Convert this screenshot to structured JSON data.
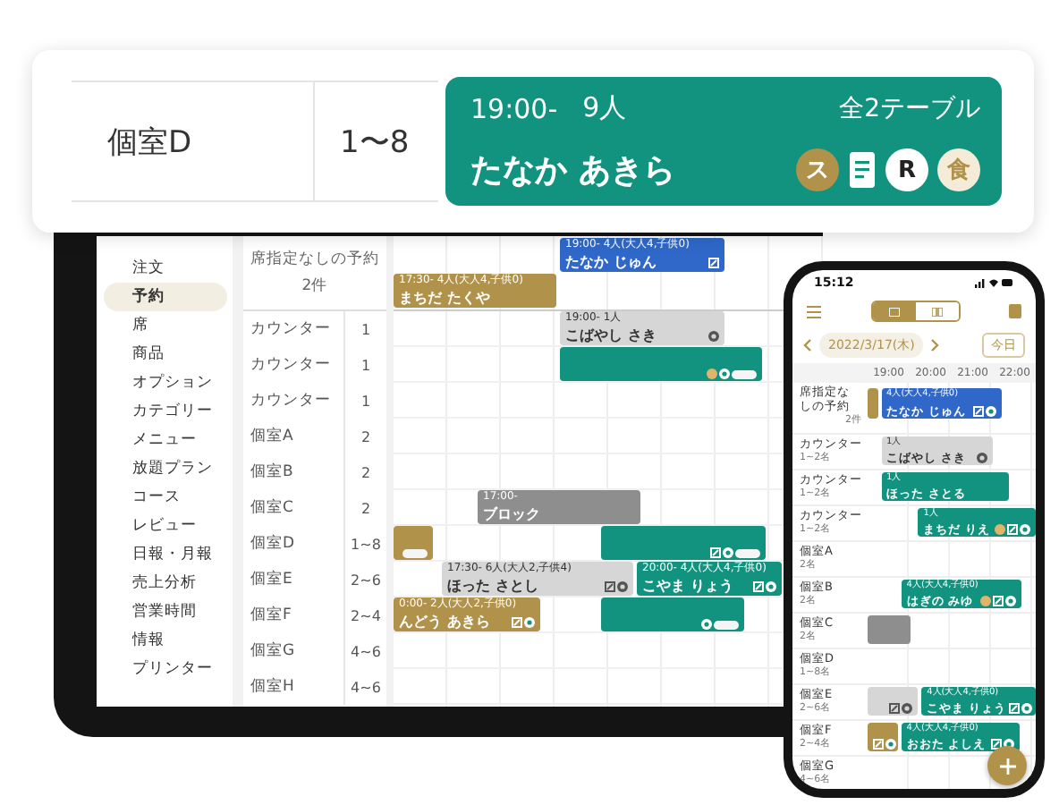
{
  "callout": {
    "seat": "個室D",
    "capacity": "1〜8",
    "booking": {
      "time": "19:00-",
      "party": "9人",
      "tables": "全2テーブル",
      "name": "たなか あきら",
      "color": "#12937f",
      "badges": [
        {
          "kind": "letter",
          "text": "ス"
        },
        {
          "kind": "document"
        },
        {
          "kind": "logo",
          "text": "R"
        },
        {
          "kind": "cream",
          "text": "食"
        }
      ]
    }
  },
  "tablet": {
    "sidebar": [
      {
        "label": "注文",
        "selected": false
      },
      {
        "label": "予約",
        "selected": true
      },
      {
        "label": "席",
        "selected": false
      },
      {
        "label": "商品",
        "selected": false
      },
      {
        "label": "オプション",
        "selected": false
      },
      {
        "label": "カテゴリー",
        "selected": false
      },
      {
        "label": "メニュー",
        "selected": false
      },
      {
        "label": "放題プラン",
        "selected": false
      },
      {
        "label": "コース",
        "selected": false
      },
      {
        "label": "レビュー",
        "selected": false
      },
      {
        "label": "日報・月報",
        "selected": false
      },
      {
        "label": "売上分析",
        "selected": false
      },
      {
        "label": "営業時間",
        "selected": false
      },
      {
        "label": "情報",
        "selected": false
      },
      {
        "label": "プリンター",
        "selected": false
      }
    ],
    "unassigned": {
      "label": "席指定なしの予約",
      "count": "2件",
      "bookings": [
        {
          "time": "19:00-  4人(大人4,子供0)",
          "name": "たなか じゅん",
          "color": "#2f68c8",
          "icons": [
            {
              "kind": "edit"
            }
          ]
        },
        {
          "time": "17:30-  4人(大人4,子供0)",
          "name": "まちだ たくや",
          "color": "#b0924a"
        }
      ]
    },
    "rows": [
      {
        "name": "カウンター",
        "capacity": "1",
        "bookings": [
          {
            "time": "19:00-  1人",
            "name": "こばやし さき",
            "color": "#d6d6d6",
            "icons": [
              {
                "kind": "seat"
              }
            ]
          }
        ]
      },
      {
        "name": "カウンター",
        "capacity": "1",
        "bookings": [
          {
            "color": "#12937f",
            "icons": [
              {
                "kind": "person"
              },
              {
                "kind": "seat"
              },
              {
                "kind": "tag"
              }
            ]
          }
        ]
      },
      {
        "name": "カウンター",
        "capacity": "1",
        "bookings": []
      },
      {
        "name": "個室A",
        "capacity": "2",
        "bookings": []
      },
      {
        "name": "個室B",
        "capacity": "2",
        "bookings": []
      },
      {
        "name": "個室C",
        "capacity": "2",
        "bookings": [
          {
            "time": "17:00-",
            "name": "ブロック",
            "color": "#8e8e8e"
          }
        ]
      },
      {
        "name": "個室D",
        "capacity": "1~8",
        "bookings": [
          {
            "color": "#b0924a",
            "icons": [
              {
                "kind": "tag"
              }
            ]
          },
          {
            "color": "#12937f",
            "icons": [
              {
                "kind": "edit"
              },
              {
                "kind": "seat"
              },
              {
                "kind": "tag"
              }
            ]
          }
        ]
      },
      {
        "name": "個室E",
        "capacity": "2~6",
        "bookings": [
          {
            "time": "17:30-  6人(大人2,子供4)",
            "name": "ほった さとし",
            "color": "#d6d6d6",
            "icons": [
              {
                "kind": "edit"
              },
              {
                "kind": "seat"
              }
            ]
          },
          {
            "time": "20:00-  4人(大人4,子供0)",
            "name": "こやま りょう",
            "color": "#12937f",
            "icons": [
              {
                "kind": "edit"
              },
              {
                "kind": "seat"
              }
            ]
          }
        ]
      },
      {
        "name": "個室F",
        "capacity": "2~4",
        "bookings": [
          {
            "time": "0:00-  2人(大人2,子供0)",
            "name": "んどう あきら",
            "color": "#b0924a",
            "icons": [
              {
                "kind": "edit"
              },
              {
                "kind": "seat"
              }
            ]
          },
          {
            "color": "#12937f",
            "icons": [
              {
                "kind": "seat"
              },
              {
                "kind": "tag"
              }
            ]
          }
        ]
      },
      {
        "name": "個室G",
        "capacity": "4~6",
        "bookings": []
      },
      {
        "name": "個室H",
        "capacity": "4~6",
        "bookings": []
      }
    ]
  },
  "phone": {
    "time": "15:12",
    "views": [
      {
        "selected": true
      },
      {
        "selected": false
      }
    ],
    "date": "2022/3/17(木)",
    "today": "今日",
    "hours": [
      "19:00",
      "20:00",
      "21:00",
      "22:00"
    ],
    "unassigned": {
      "label": "席指定なしの予約",
      "count": "2件",
      "bookings": [
        {
          "color": "#b0924a"
        },
        {
          "name": "たなか じゅん",
          "time": "4人(大人4,子供0)",
          "color": "#2f68c8",
          "icons": [
            {
              "kind": "edit"
            },
            {
              "kind": "seat"
            }
          ]
        }
      ]
    },
    "rows": [
      {
        "name": "カウンター",
        "capacity": "1~2名",
        "bookings": [
          {
            "name": "こばやし さき",
            "time": "1人",
            "color": "#d6d6d6",
            "icons": [
              {
                "kind": "seat"
              }
            ]
          }
        ]
      },
      {
        "name": "カウンター",
        "capacity": "1~2名",
        "bookings": [
          {
            "name": "ほった さとる",
            "time": "1人",
            "color": "#12937f"
          }
        ]
      },
      {
        "name": "カウンター",
        "capacity": "1~2名",
        "bookings": [
          {
            "name": "まちだ りえ",
            "time": "1人",
            "color": "#12937f",
            "icons": [
              {
                "kind": "person"
              },
              {
                "kind": "edit"
              },
              {
                "kind": "seat"
              }
            ]
          }
        ]
      },
      {
        "name": "個室A",
        "capacity": "2名",
        "bookings": []
      },
      {
        "name": "個室B",
        "capacity": "2名",
        "bookings": [
          {
            "name": "はぎの みゆ",
            "time": "4人(大人4,子供0)",
            "color": "#12937f",
            "icons": [
              {
                "kind": "person"
              },
              {
                "kind": "edit"
              },
              {
                "kind": "seat"
              }
            ]
          }
        ]
      },
      {
        "name": "個室C",
        "capacity": "2名",
        "bookings": [
          {
            "color": "#8e8e8e"
          }
        ]
      },
      {
        "name": "個室D",
        "capacity": "1~8名",
        "bookings": []
      },
      {
        "name": "個室E",
        "capacity": "2~6名",
        "bookings": [
          {
            "color": "#d6d6d6",
            "icons": [
              {
                "kind": "edit"
              },
              {
                "kind": "seat"
              }
            ]
          },
          {
            "name": "こやま りょう",
            "time": "4人(大人4,子供0)",
            "color": "#12937f",
            "icons": [
              {
                "kind": "edit"
              },
              {
                "kind": "seat"
              }
            ]
          }
        ]
      },
      {
        "name": "個室F",
        "capacity": "2~4名",
        "bookings": [
          {
            "color": "#b0924a",
            "icons": [
              {
                "kind": "edit"
              },
              {
                "kind": "seat"
              }
            ]
          },
          {
            "name": "おおた よしえ",
            "time": "4人(大人4,子供0)",
            "color": "#12937f",
            "icons": [
              {
                "kind": "edit"
              },
              {
                "kind": "seat"
              }
            ]
          }
        ]
      },
      {
        "name": "個室G",
        "capacity": "4~6名",
        "bookings": []
      }
    ]
  }
}
